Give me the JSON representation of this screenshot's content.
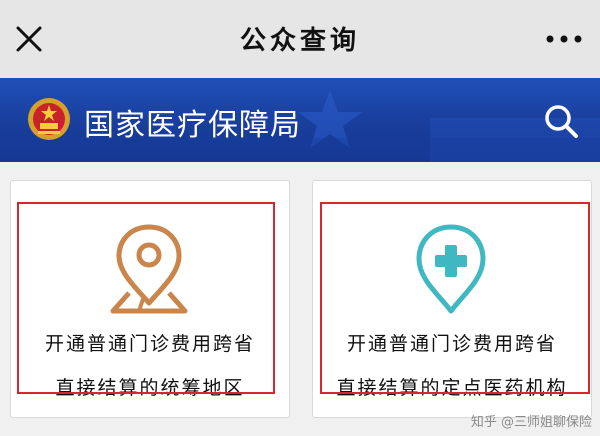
{
  "topbar": {
    "title": "公众查询"
  },
  "banner": {
    "title": "国家医疗保障局"
  },
  "cards": [
    {
      "line1": "开通普通门诊费用跨省",
      "line2": "直接结算的统筹地区",
      "accent": "#c9854a"
    },
    {
      "line1": "开通普通门诊费用跨省",
      "line2": "直接结算的定点医药机构",
      "accent": "#3fb8c2"
    }
  ],
  "watermark": "知乎 @三师姐聊保险",
  "colors": {
    "banner_blue": "#1a3f9e",
    "highlight_red": "#d8262f"
  },
  "icons": [
    "close-icon",
    "more-icon",
    "national-emblem-icon",
    "search-icon",
    "map-pin-icon",
    "medical-pin-icon"
  ]
}
